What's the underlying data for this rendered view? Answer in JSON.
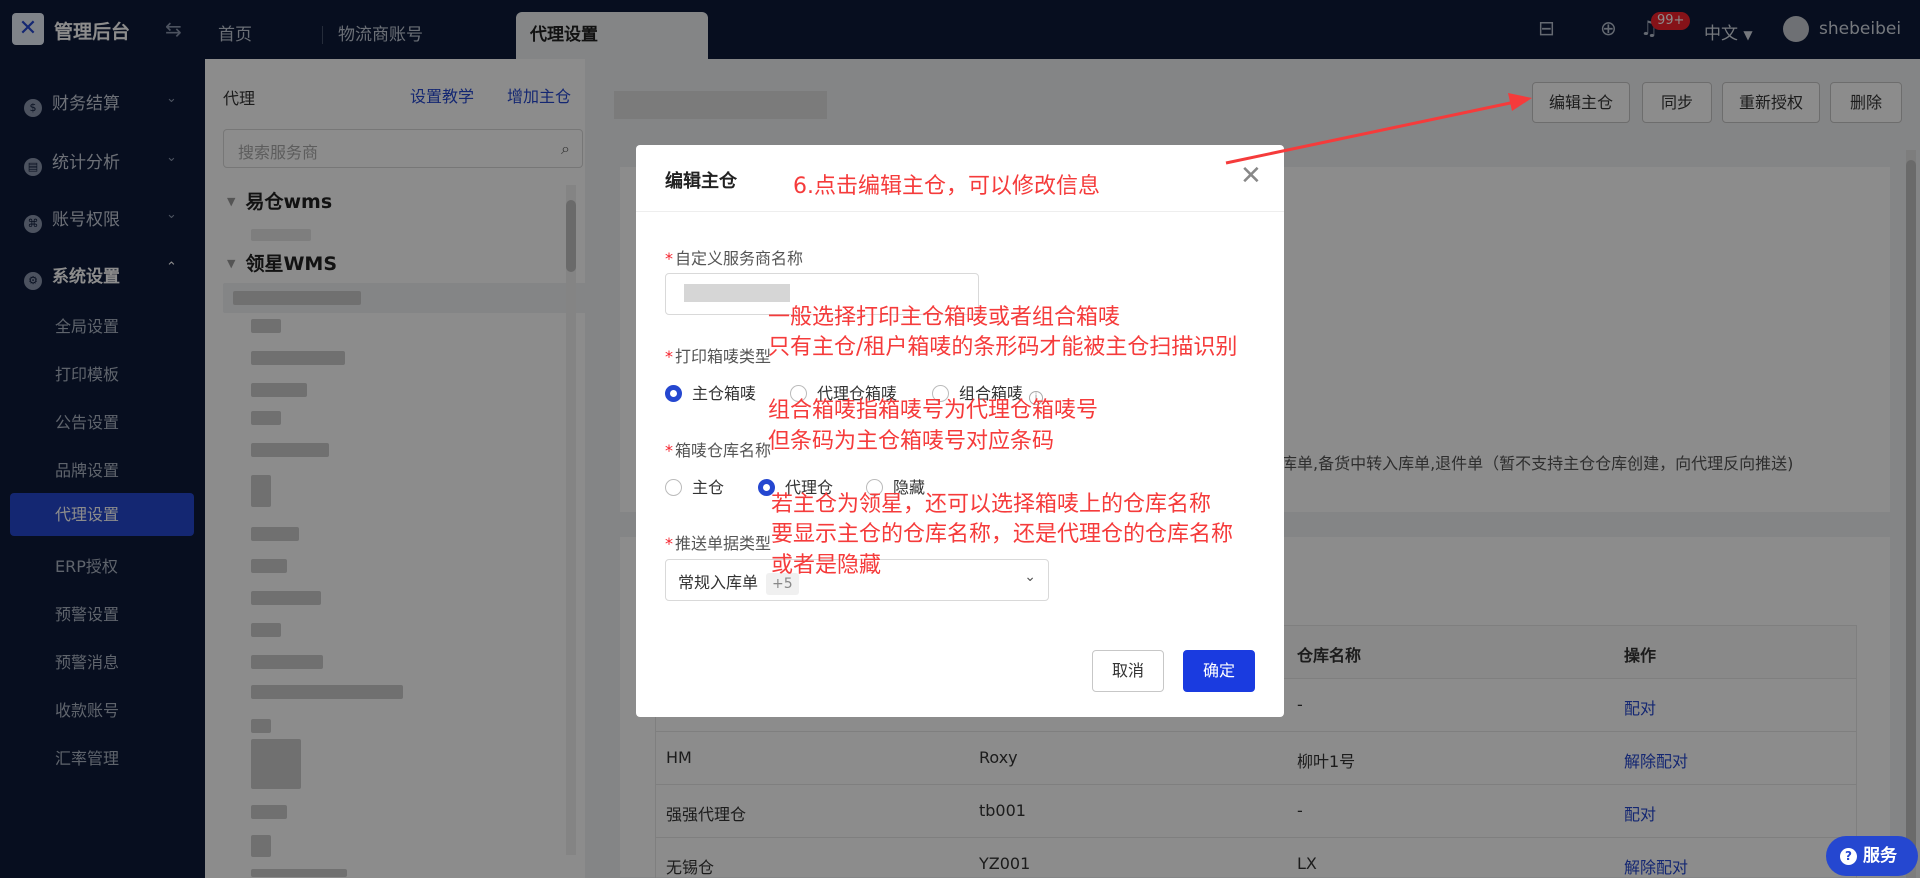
{
  "topbar": {
    "brand": "管理后台",
    "tabs": [
      {
        "label": "首页"
      },
      {
        "label": "物流商账号"
      },
      {
        "label": "代理设置"
      }
    ],
    "badge": "99+",
    "language": "中文",
    "username": "shebeibei"
  },
  "sidebar": {
    "groups": [
      {
        "label": "财务结算"
      },
      {
        "label": "统计分析"
      },
      {
        "label": "账号权限"
      },
      {
        "label": "系统设置"
      }
    ],
    "items": [
      {
        "label": "全局设置"
      },
      {
        "label": "打印模板"
      },
      {
        "label": "公告设置"
      },
      {
        "label": "品牌设置"
      },
      {
        "label": "代理设置"
      },
      {
        "label": "ERP授权"
      },
      {
        "label": "预警设置"
      },
      {
        "label": "预警消息"
      },
      {
        "label": "收款账号"
      },
      {
        "label": "汇率管理"
      }
    ]
  },
  "left_panel": {
    "title": "代理",
    "link_tutorial": "设置教学",
    "link_add": "增加主仓",
    "search_placeholder": "搜索服务商",
    "tree": [
      {
        "label": "易仓wms"
      },
      {
        "label": "领星WMS"
      }
    ]
  },
  "main": {
    "buttons": {
      "edit": "编辑主仓",
      "sync": "同步",
      "reauth": "重新授权",
      "delete": "删除"
    },
    "info_text": "库单,备货中转入库单,退件单（暂不支持主仓仓库创建，向代理反向推送)",
    "table": {
      "headers": [
        "仓库名称",
        "操作"
      ],
      "rows": [
        {
          "c1": "",
          "c2": "",
          "c3": "-",
          "op": "配对"
        },
        {
          "c1": "HM",
          "c2": "Roxy",
          "c3": "柳叶1号",
          "op": "解除配对"
        },
        {
          "c1": "强强代理仓",
          "c2": "tb001",
          "c3": "-",
          "op": "配对"
        },
        {
          "c1": "无锡仓",
          "c2": "YZ001",
          "c3": "LX",
          "op": "解除配对"
        }
      ]
    }
  },
  "modal": {
    "title": "编辑主仓",
    "field_name_label": "自定义服务商名称",
    "field_print_label": "打印箱唛类型",
    "print_options": [
      {
        "label": "主仓箱唛"
      },
      {
        "label": "代理仓箱唛"
      },
      {
        "label": "组合箱唛"
      }
    ],
    "print_selected": "主仓箱唛",
    "field_wh_label": "箱唛仓库名称",
    "wh_options": [
      {
        "label": "主仓"
      },
      {
        "label": "代理仓"
      },
      {
        "label": "隐藏"
      }
    ],
    "wh_selected": "代理仓",
    "field_push_label": "推送单据类型",
    "push_value": "常规入库单",
    "push_more": "+5",
    "cancel": "取消",
    "confirm": "确定"
  },
  "annotations": {
    "a1": "6.点击编辑主仓，可以修改信息",
    "a2": "一般选择打印主仓箱唛或者组合箱唛",
    "a3": "只有主仓/租户箱唛的条形码才能被主仓扫描识别",
    "a4": "组合箱唛指箱唛号为代理仓箱唛号",
    "a5": "但条码为主仓箱唛号对应条码",
    "a6": "若主仓为领星，还可以选择箱唛上的仓库名称",
    "a7": "要显示主仓的仓库名称，还是代理仓的仓库名称",
    "a8": "或者是隐藏"
  },
  "service_button": "服务",
  "colors": {
    "primary": "#2547d0",
    "nav_bg": "#0d1b3a",
    "annotation": "#f53b3b",
    "badge": "#f5222d"
  },
  "icons": [
    "logo-icon",
    "swap-icon",
    "inbox-icon",
    "download-icon",
    "bell-icon",
    "caret-down-icon",
    "search-icon",
    "close-icon",
    "info-icon",
    "menu-icon",
    "question-icon"
  ]
}
